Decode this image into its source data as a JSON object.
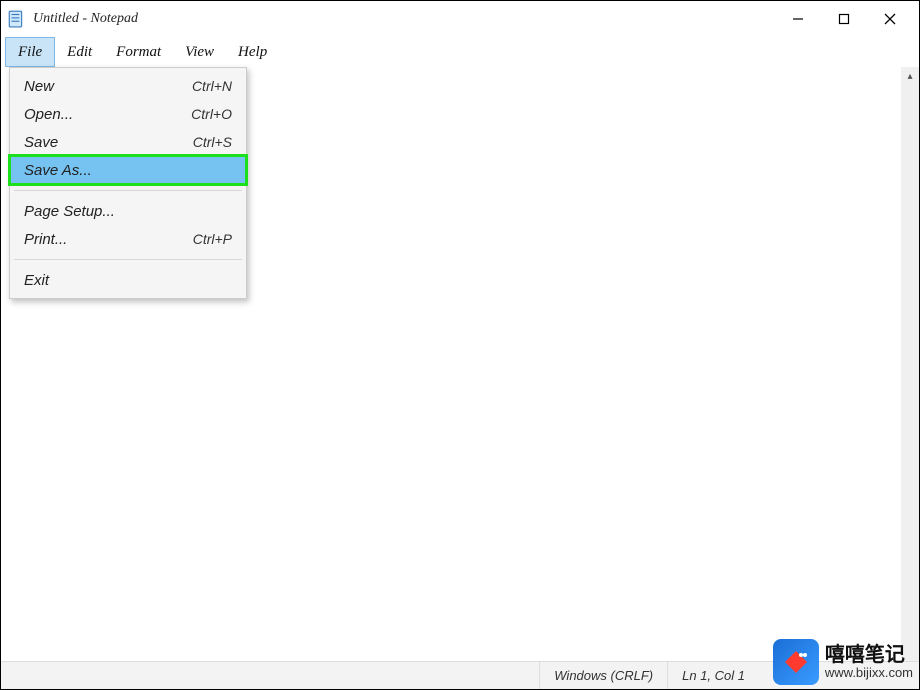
{
  "window": {
    "title": "Untitled - Notepad"
  },
  "menubar": {
    "items": [
      "File",
      "Edit",
      "Format",
      "View",
      "Help"
    ],
    "activeIndex": 0
  },
  "fileMenu": {
    "items": [
      {
        "label": "New",
        "shortcut": "Ctrl+N"
      },
      {
        "label": "Open...",
        "shortcut": "Ctrl+O"
      },
      {
        "label": "Save",
        "shortcut": "Ctrl+S"
      },
      {
        "label": "Save As...",
        "shortcut": "",
        "highlighted": true
      },
      {
        "separator": true
      },
      {
        "label": "Page Setup...",
        "shortcut": ""
      },
      {
        "label": "Print...",
        "shortcut": "Ctrl+P"
      },
      {
        "separator": true
      },
      {
        "label": "Exit",
        "shortcut": ""
      }
    ]
  },
  "statusbar": {
    "lineEnding": "Windows (CRLF)",
    "position": "Ln 1, Col 1"
  },
  "watermark": {
    "line1": "嘻嘻笔记",
    "line2": "www.bijixx.com"
  }
}
